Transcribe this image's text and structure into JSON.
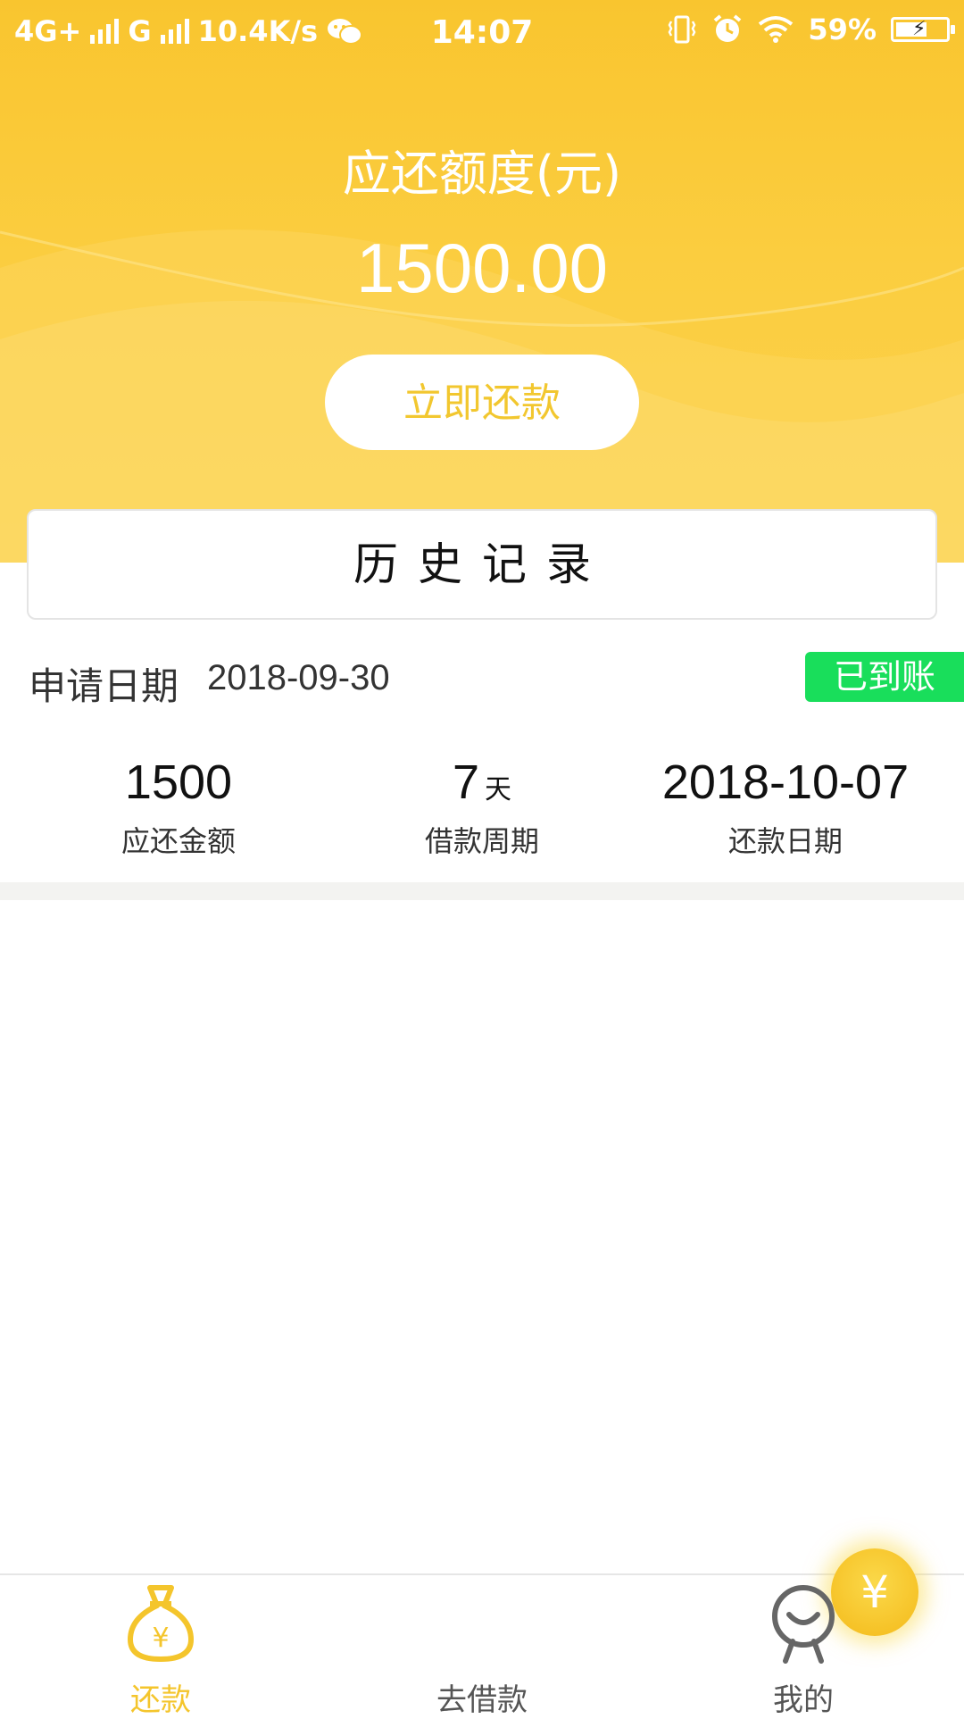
{
  "status_bar": {
    "network_1": "4G+",
    "network_2": "G",
    "speed": "10.4K/s",
    "time": "14:07",
    "battery": "59%",
    "icons": [
      "signal-icon",
      "wechat-icon",
      "vibrate-icon",
      "alarm-icon",
      "wifi-icon",
      "battery-charging-icon"
    ]
  },
  "header": {
    "label": "应还额度(元)",
    "amount": "1500.00",
    "repay_button": "立即还款"
  },
  "history": {
    "title": "历史记录"
  },
  "record": {
    "apply_label": "申请日期",
    "apply_date": "2018-09-30",
    "status": "已到账",
    "amount_value": "1500",
    "amount_label": "应还金额",
    "period_value": "7",
    "period_unit": "天",
    "period_label": "借款周期",
    "due_value": "2018-10-07",
    "due_label": "还款日期"
  },
  "tabbar": {
    "tabs": [
      {
        "label": "还款",
        "icon": "money-bag-icon",
        "active": true
      },
      {
        "label": "去借款",
        "icon": "yen-coin-icon",
        "active": false
      },
      {
        "label": "我的",
        "icon": "profile-face-icon",
        "active": false
      }
    ],
    "center_symbol": "¥",
    "bag_symbol": "¥"
  },
  "colors": {
    "accent": "#f4c52c",
    "status_green": "#19de5b",
    "header_bg": "#fbcd3f"
  }
}
